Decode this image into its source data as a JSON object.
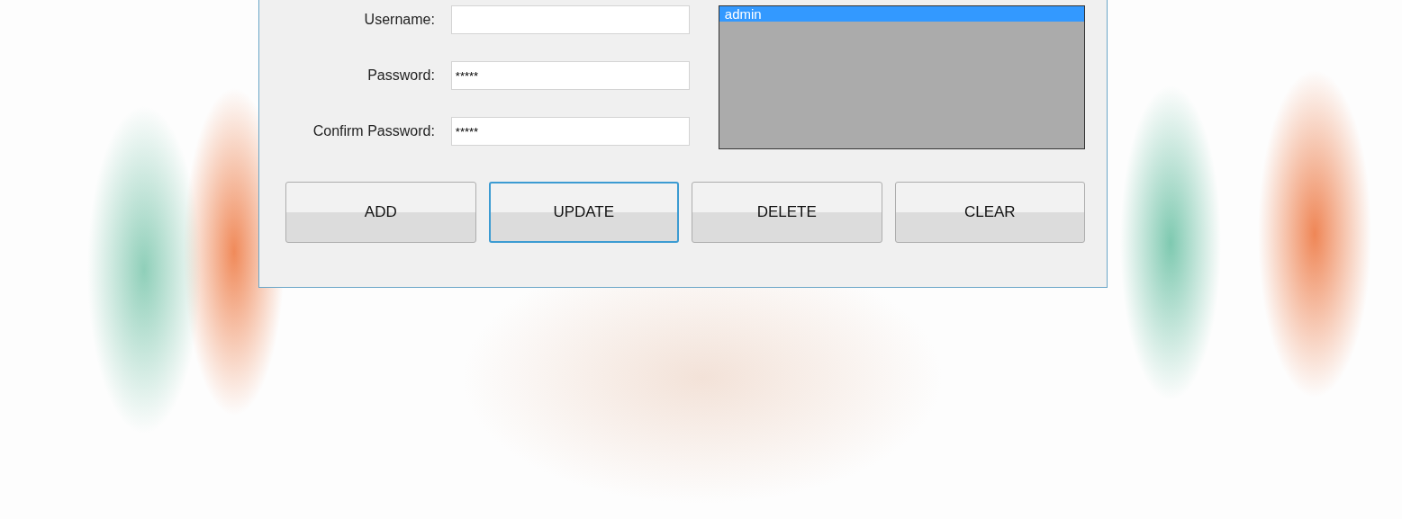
{
  "form": {
    "fields": [
      {
        "label": "Username:"
      },
      {
        "label": "Password:",
        "value": "*****"
      },
      {
        "label": "Confirm Password:",
        "value": "*****"
      }
    ],
    "list": {
      "items": [
        {
          "label": "admin",
          "selected": true
        }
      ]
    },
    "buttons": [
      {
        "label": "ADD",
        "focused": false
      },
      {
        "label": "UPDATE",
        "focused": true
      },
      {
        "label": "DELETE",
        "focused": false
      },
      {
        "label": "CLEAR",
        "focused": false
      }
    ]
  }
}
